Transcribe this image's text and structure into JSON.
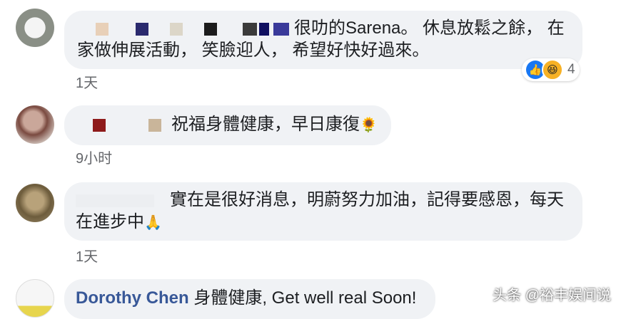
{
  "comments": [
    {
      "text": "很叻的Sarena。 休息放鬆之餘， 在家做伸展活動， 笑臉迎人， 希望好快好過來。",
      "time": "1天",
      "reaction_count": "4"
    },
    {
      "text": "祝福身體健康，早日康復",
      "emoji": "🌻",
      "time": "9小时"
    },
    {
      "text": "實在是很好消息，明蔚努力加油，記得要感恩，每天在進步中",
      "emoji": "🙏",
      "time": "1天"
    },
    {
      "author": "Dorothy Chen",
      "text": "身體健康, Get well real Soon!"
    }
  ],
  "watermark": "头条 @裕丰娱间说",
  "colors": {
    "bubble": "#f0f2f5",
    "author": "#385898",
    "time": "#65676b",
    "like": "#1877f2",
    "haha": "#f7b125"
  }
}
